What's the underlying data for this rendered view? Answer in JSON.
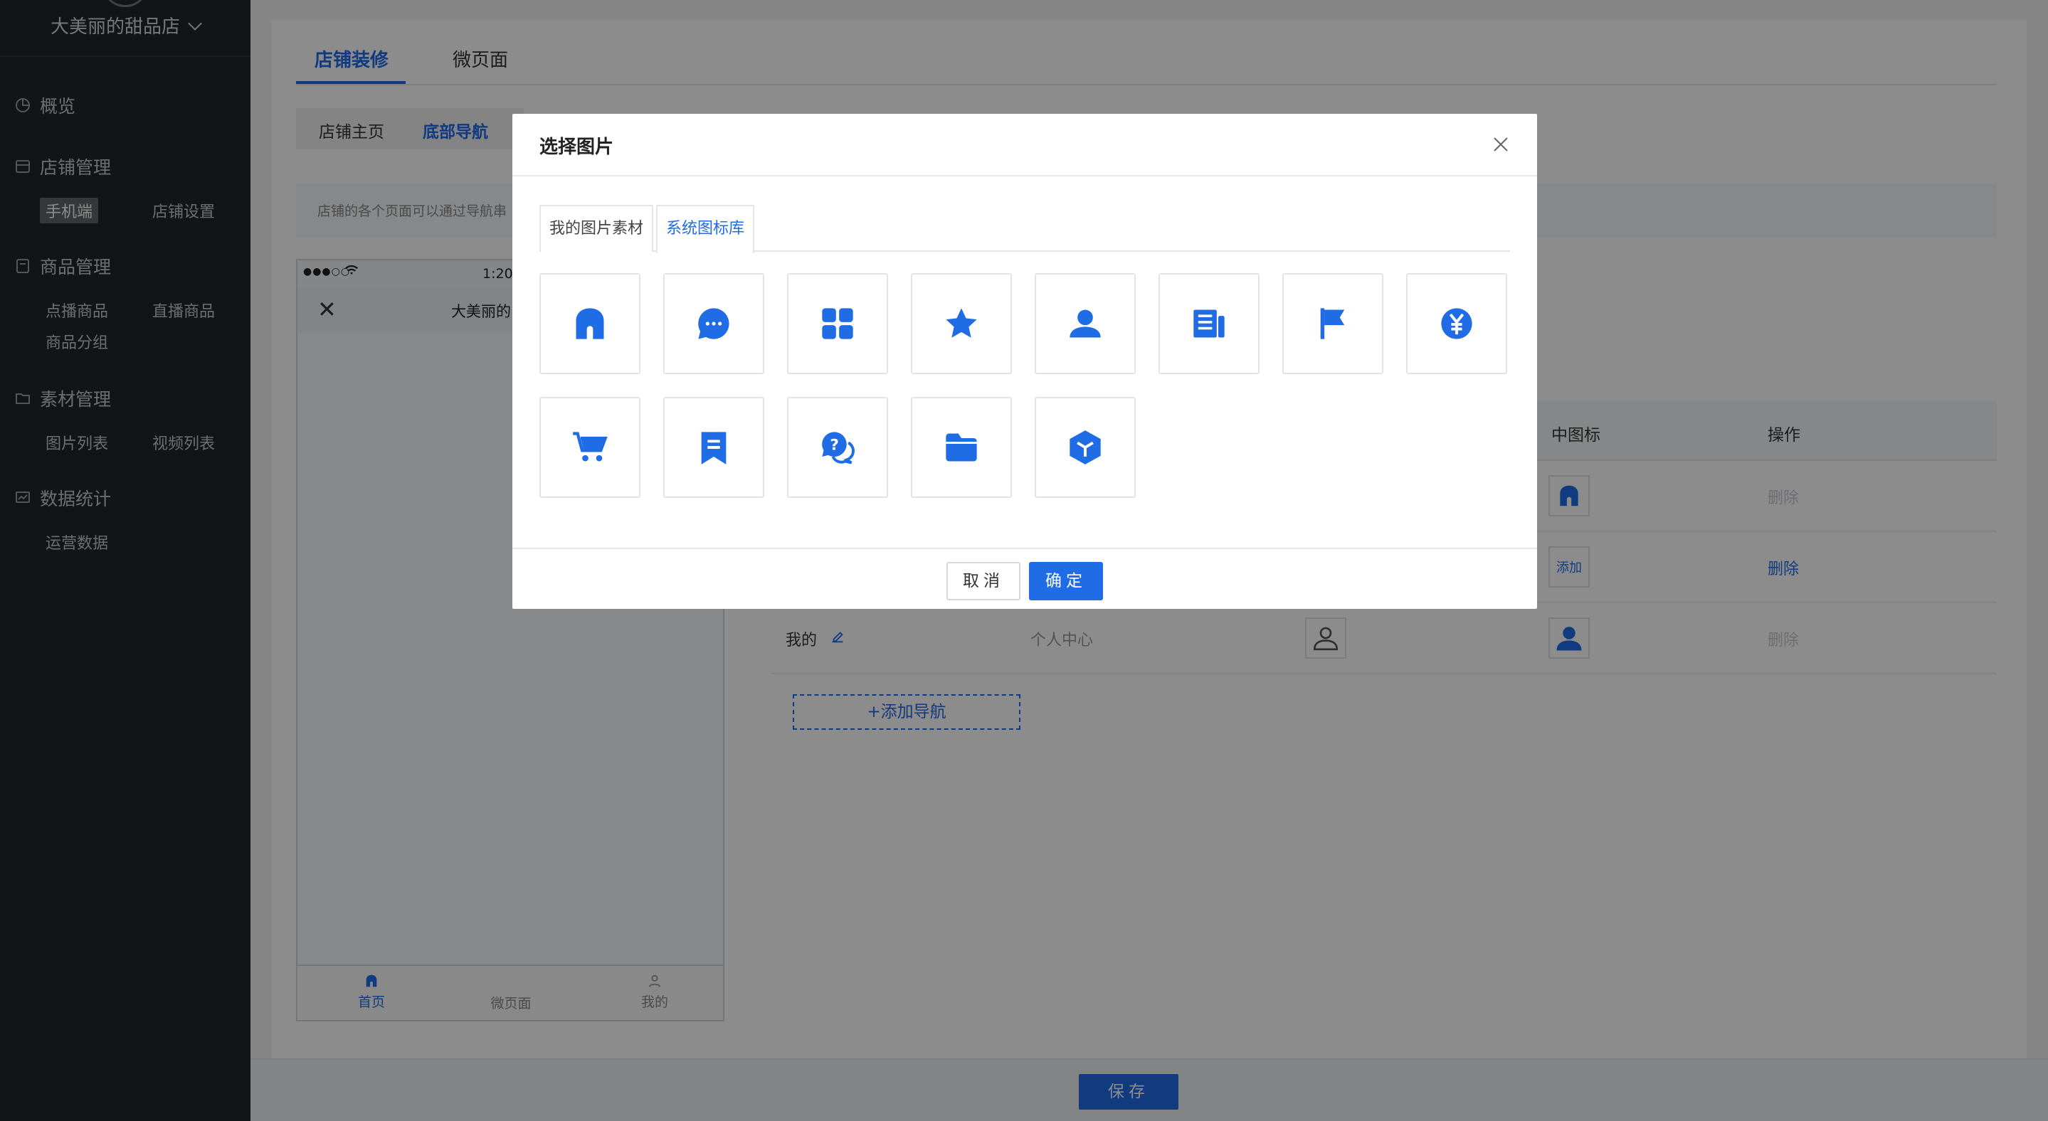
{
  "sidebar": {
    "shop_name": "大美丽的甜品店",
    "sections": [
      {
        "label": "概览",
        "icon": "pie-chart-icon"
      },
      {
        "label": "店铺管理",
        "icon": "shop-icon",
        "items": [
          "手机端",
          "店铺设置"
        ]
      },
      {
        "label": "商品管理",
        "icon": "goods-icon",
        "items": [
          "点播商品",
          "直播商品",
          "商品分组"
        ]
      },
      {
        "label": "素材管理",
        "icon": "folder-icon",
        "items": [
          "图片列表",
          "视频列表"
        ]
      },
      {
        "label": "数据统计",
        "icon": "chart-icon",
        "items": [
          "运营数据"
        ]
      }
    ]
  },
  "main": {
    "top_tabs": [
      "店铺装修",
      "微页面"
    ],
    "sub_tabs": [
      "店铺主页",
      "底部导航"
    ],
    "hint": "店铺的各个页面可以通过导航串",
    "phone": {
      "dots": "●●●○○",
      "time": "1:20",
      "title": "大美丽的",
      "close": "✕",
      "tabs": [
        "首页",
        "微页面",
        "我的"
      ]
    },
    "table": {
      "headers": [
        "中图标",
        "操作"
      ],
      "rows": [
        {
          "name": "",
          "page": "",
          "action": "删除",
          "action_enabled": false
        },
        {
          "name": "",
          "page": "",
          "selected_icon_text": "添加",
          "action": "删除",
          "action_enabled": true
        },
        {
          "name": "我的",
          "page": "个人中心",
          "action": "删除",
          "action_enabled": false
        }
      ],
      "add_nav": "+添加导航"
    }
  },
  "footer": {
    "save": "保存"
  },
  "modal": {
    "title": "选择图片",
    "tabs": [
      "我的图片素材",
      "系统图标库"
    ],
    "active_tab": "系统图标库",
    "icons": [
      "home-icon",
      "chat-bubble-icon",
      "grid-apps-icon",
      "star-icon",
      "user-icon",
      "news-icon",
      "flag-icon",
      "yen-coin-icon",
      "cart-icon",
      "bookmark-icon",
      "help-chat-icon",
      "folder-icon",
      "cube-icon"
    ],
    "cancel": "取消",
    "ok": "确定"
  },
  "colors": {
    "accent": "#1f6ce5",
    "sidebar_bg": "#22252c"
  }
}
